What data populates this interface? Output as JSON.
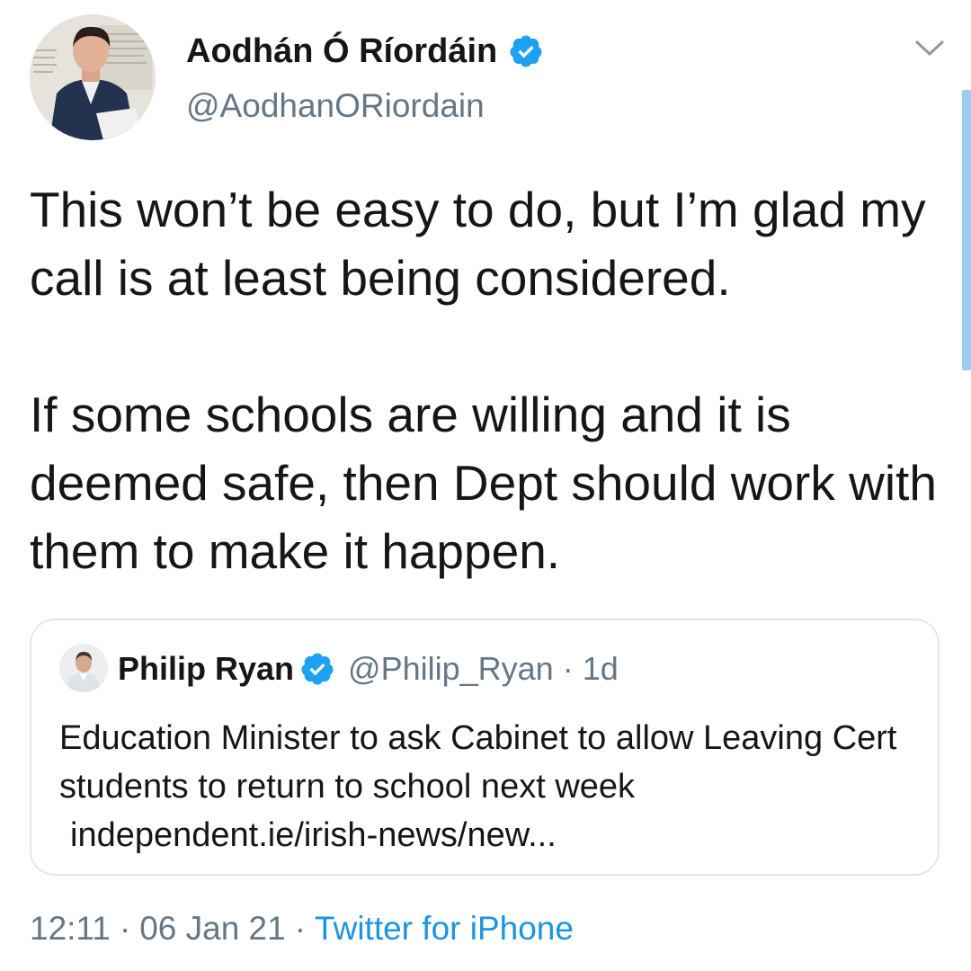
{
  "tweet": {
    "author": {
      "display_name": "Aodhán Ó Ríordáin",
      "handle": "@AodhanORiordain",
      "verified": true
    },
    "text_paragraphs": [
      "This won’t be easy to do, but I’m glad my call is at least being considered.",
      "If some schools are willing and it is deemed safe, then Dept should work with them to make it happen."
    ],
    "timestamp": {
      "time": "12:11",
      "separator": "·",
      "date": "06 Jan 21",
      "source": "Twitter for iPhone"
    }
  },
  "quoted_tweet": {
    "author_name": "Philip Ryan",
    "handle": "@Philip_Ryan",
    "separator": "·",
    "age": "1d",
    "verified": true,
    "text": "Education Minister to ask Cabinet to allow Leaving Cert students to return to school next week",
    "link": "independent.ie/irish-news/new..."
  },
  "colors": {
    "text": "#14171a",
    "secondary": "#657786",
    "accent": "#1da1f2",
    "link": "#1b95e0",
    "border": "#e1e8ed"
  },
  "icons": {
    "verified": "verified-badge-icon",
    "menu": "chevron-down-icon"
  }
}
